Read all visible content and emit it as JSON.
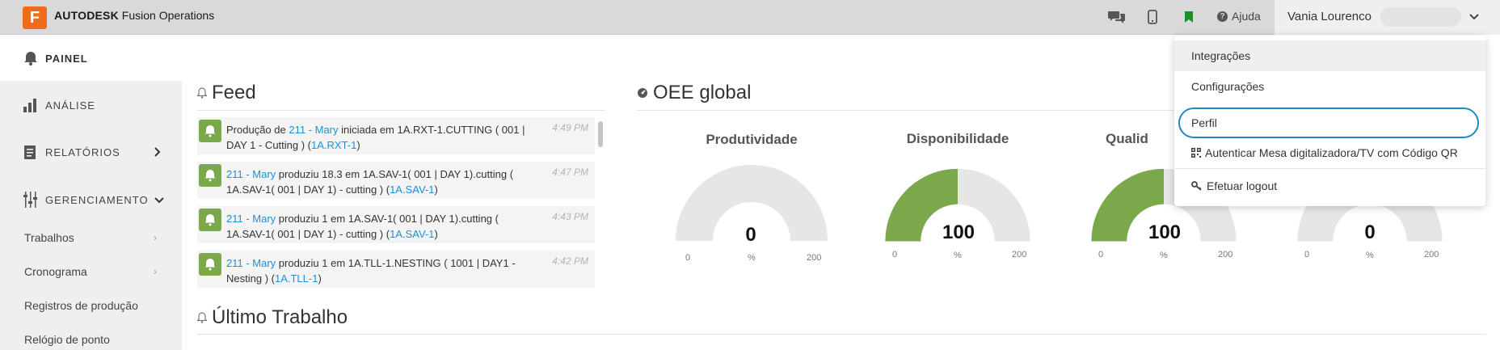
{
  "header": {
    "logo_letter": "F",
    "brand_bold": "AUTODESK",
    "brand_rest": "Fusion Operations",
    "help_label": "Ajuda",
    "user_name": "Vania Lourenco",
    "icons": [
      "chat-icon",
      "mobile-icon",
      "bookmark-icon",
      "help-icon",
      "chevron-down-icon"
    ],
    "bookmark_color": "#1a8f2a"
  },
  "sidebar": {
    "panel_label": "PAINEL",
    "items": [
      {
        "label": "ANÁLISE"
      },
      {
        "label": "RELATÓRIOS"
      },
      {
        "label": "GERENCIAMENTO"
      }
    ],
    "sub_items": [
      {
        "label": "Trabalhos"
      },
      {
        "label": "Cronograma"
      },
      {
        "label": "Registros de produção"
      },
      {
        "label": "Relógio de ponto"
      }
    ]
  },
  "feed": {
    "title": "Feed",
    "entries": [
      {
        "pre": "Produção de ",
        "link1": "211 - Mary",
        "mid": " iniciada em 1A.RXT-1.CUTTING ( 001 | DAY 1 - Cutting ) (",
        "link2": "1A.RXT-1",
        "post": ")",
        "time": "4:49 PM"
      },
      {
        "pre": "",
        "link1": "211 - Mary",
        "mid": " produziu 18.3 em 1A.SAV-1( 001 | DAY 1).cutting ( 1A.SAV-1( 001 | DAY 1) - cutting ) (",
        "link2": "1A.SAV-1",
        "post": ")",
        "time": "4:47 PM"
      },
      {
        "pre": "",
        "link1": "211 - Mary",
        "mid": " produziu 1 em 1A.SAV-1( 001 | DAY 1).cutting ( 1A.SAV-1( 001 | DAY 1) - cutting ) (",
        "link2": "1A.SAV-1",
        "post": ")",
        "time": "4:43 PM"
      },
      {
        "pre": "",
        "link1": "211 - Mary",
        "mid": " produziu 1 em 1A.TLL-1.NESTING ( 1001 | DAY1 - Nesting ) (",
        "link2": "1A.TLL-1",
        "post": ")",
        "time": "4:42 PM"
      }
    ]
  },
  "last_job": {
    "title": "Último Trabalho"
  },
  "oee": {
    "title": "OEE global",
    "accent": "#7aa84a",
    "track": "#e6e6e6",
    "gauges": [
      {
        "title": "Produtividade",
        "value": "0",
        "fraction": 0,
        "unit": "%",
        "min": "0",
        "max": "200"
      },
      {
        "title": "Disponibilidade",
        "value": "100",
        "fraction": 0.5,
        "unit": "%",
        "min": "0",
        "max": "200"
      },
      {
        "title": "Qualid",
        "value": "100",
        "fraction": 0.5,
        "unit": "%",
        "min": "0",
        "max": "200"
      },
      {
        "title": "",
        "value": "0",
        "fraction": 0,
        "unit": "%",
        "min": "0",
        "max": "200"
      }
    ]
  },
  "user_menu": {
    "items": [
      {
        "label": "Integrações"
      },
      {
        "label": "Configurações"
      },
      {
        "label": "Perfil"
      },
      {
        "label": "Autenticar Mesa digitalizadora/TV com Código QR"
      },
      {
        "label": "Efetuar logout"
      }
    ]
  }
}
